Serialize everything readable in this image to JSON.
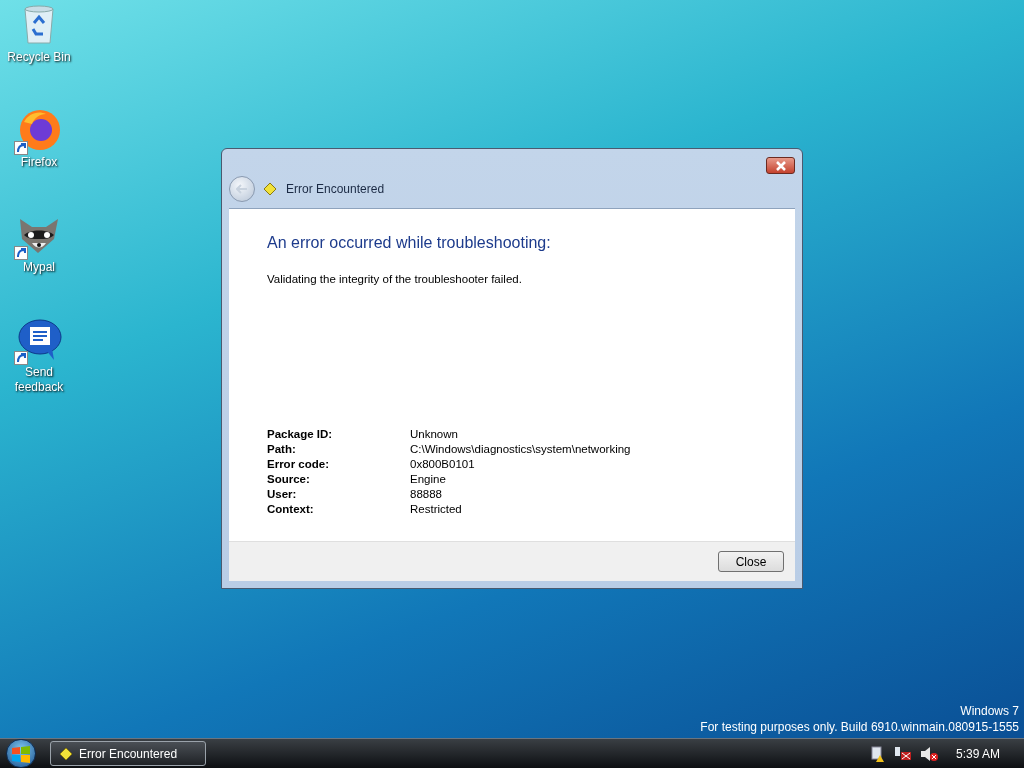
{
  "desktop_icons": [
    {
      "kind": "recycle-bin",
      "label": "Recycle Bin",
      "shortcut": false
    },
    {
      "kind": "firefox",
      "label": "Firefox",
      "shortcut": true
    },
    {
      "kind": "mypal",
      "label": "Mypal",
      "shortcut": true
    },
    {
      "kind": "feedback",
      "label": "Send feedback",
      "shortcut": true
    }
  ],
  "dialog": {
    "title": "Error Encountered",
    "heading": "An error occurred while troubleshooting:",
    "message": "Validating the integrity of the troubleshooter failed.",
    "details": [
      {
        "label": "Package ID:",
        "value": "Unknown"
      },
      {
        "label": "Path:",
        "value": "C:\\Windows\\diagnostics\\system\\networking"
      },
      {
        "label": "Error code:",
        "value": "0x800B0101"
      },
      {
        "label": "Source:",
        "value": "Engine"
      },
      {
        "label": "User:",
        "value": "88888"
      },
      {
        "label": "Context:",
        "value": "Restricted"
      }
    ],
    "buttons": [
      "Close"
    ]
  },
  "watermark": {
    "edition": "Windows 7",
    "build": "For testing purposes only. Build 6910.winmain.080915-1555"
  },
  "taskbar": {
    "tasks": [
      {
        "label": "Error Encountered",
        "selected": true
      }
    ],
    "clock": "5:39 AM"
  }
}
